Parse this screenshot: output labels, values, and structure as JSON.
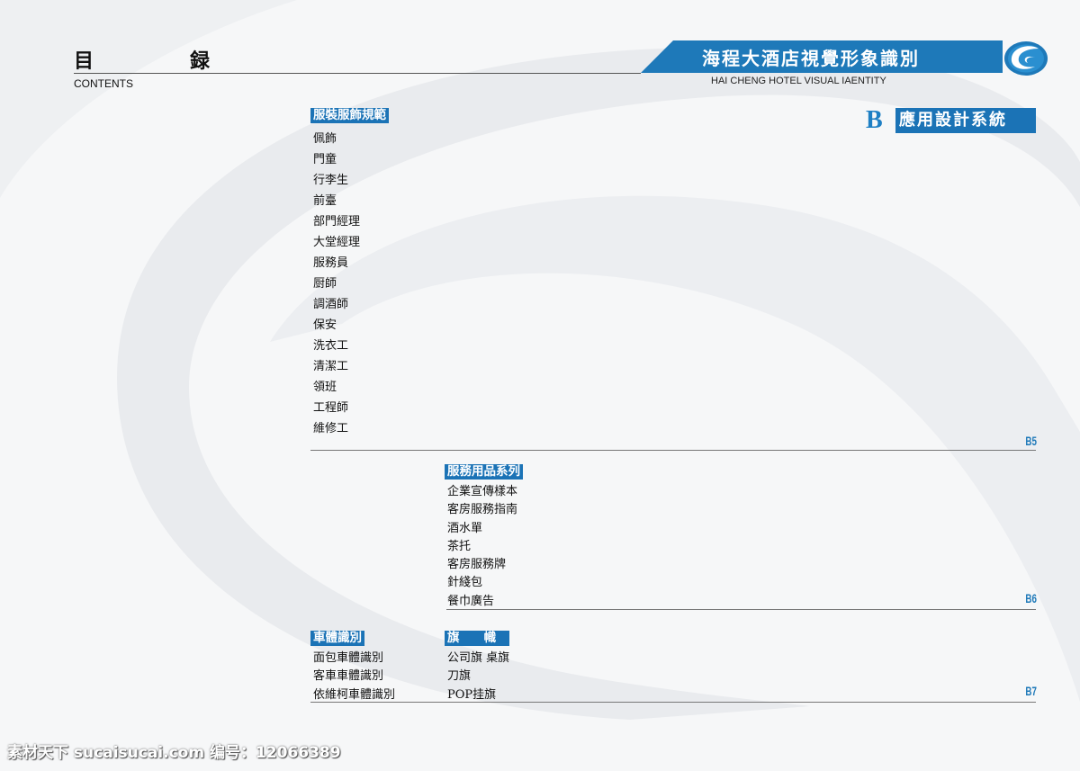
{
  "header": {
    "title_cn_1": "目",
    "title_cn_2": "録",
    "title_en": "CONTENTS",
    "banner_title": "海程大酒店視覺形象識別",
    "banner_subtitle": "HAI CHENG HOTEL VISUAL IAENTITY"
  },
  "section_badge": {
    "letter": "B",
    "label": "應用設計系統"
  },
  "sections": {
    "uniform": {
      "title": "服裝服飾規範",
      "items": [
        "佩飾",
        "門童",
        "行李生",
        "前臺",
        "部門經理",
        "大堂經理",
        "服務員",
        "厨師",
        "調酒師",
        "保安",
        "洗衣工",
        "清潔工",
        "領班",
        "工程師",
        "維修工"
      ],
      "code": "B5"
    },
    "service": {
      "title": "服務用品系列",
      "items": [
        "企業宣傳樣本",
        "客房服務指南",
        "酒水單",
        "茶托",
        "客房服務牌",
        "針綫包",
        "餐巾廣告"
      ],
      "code": "B6"
    },
    "vehicle": {
      "title": "車體識別",
      "items": [
        "面包車體識別",
        "客車車體識別",
        "依維柯車體識別"
      ]
    },
    "flags": {
      "title": "旗　　幟",
      "items": [
        "公司旗 桌旗",
        "刀旗",
        "POP挂旗"
      ],
      "code": "B7"
    }
  },
  "watermark": "素材天下 sucaisucai.com  编号：12066389",
  "colors": {
    "accent": "#1b73b6",
    "rule": "#777777"
  }
}
